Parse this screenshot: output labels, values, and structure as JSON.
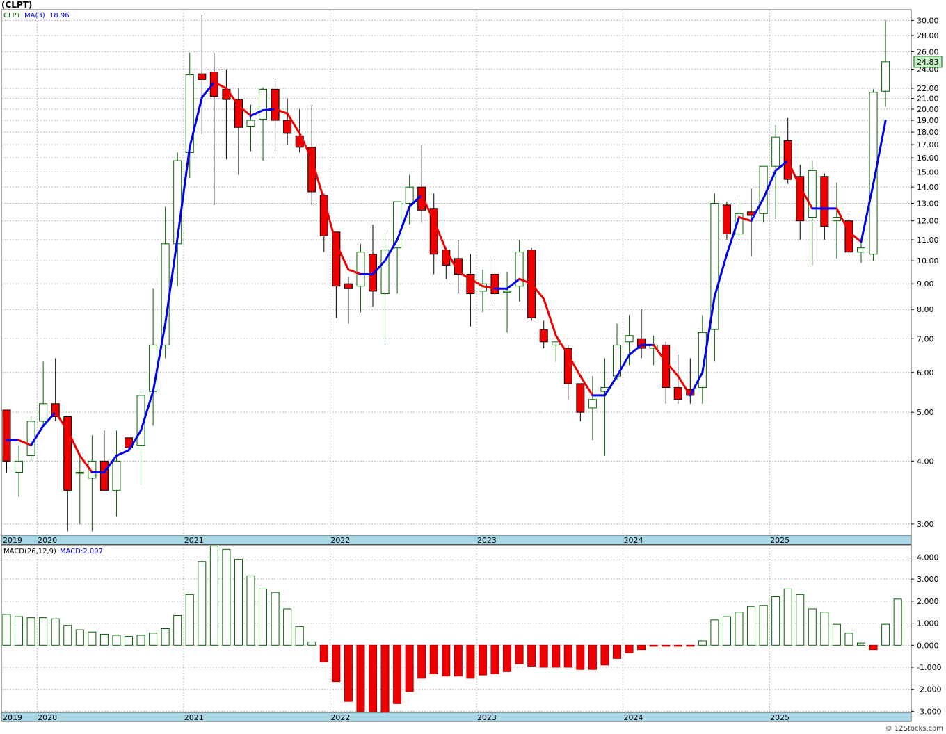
{
  "title": "(CLPT)",
  "credit": "© 12Stocks.com",
  "colors": {
    "up_outline": "#006400",
    "down_fill": "#ee0000",
    "ma_up": "#0000ee",
    "ma_down": "#ee0000",
    "grid": "#b8b8b8",
    "axis_band": "#a8d8e8",
    "price_badge": "#c8f0c8"
  },
  "price_legend": {
    "ticker": "CLPT",
    "ma_label": "MA(3)",
    "ma_value": "18.96"
  },
  "macd_legend": {
    "label": "MACD(26,12,9)",
    "value_label": "MACD:2.097"
  },
  "last_price_label": "24.83",
  "year_labels": [
    {
      "label": "2019",
      "index": -0.5
    },
    {
      "label": "2020",
      "index": 3
    },
    {
      "label": "2021",
      "index": 15
    },
    {
      "label": "2022",
      "index": 27
    },
    {
      "label": "2023",
      "index": 39
    },
    {
      "label": "2024",
      "index": 51
    },
    {
      "label": "2025",
      "index": 63
    }
  ],
  "chart_data": [
    {
      "type": "candlestick",
      "scale": "log",
      "interval": "monthly",
      "ylim": [
        2.85,
        31.5
      ],
      "y_ticks": [
        "3.00",
        "4.00",
        "5.00",
        "6.00",
        "7.00",
        "8.00",
        "9.00",
        "10.00",
        "11.00",
        "12.00",
        "13.00",
        "14.00",
        "15.00",
        "16.00",
        "17.00",
        "18.00",
        "19.00",
        "20.00",
        "21.00",
        "22.00",
        "24.00",
        "26.00",
        "28.00",
        "30.00"
      ],
      "y_tick_values": [
        3,
        4,
        5,
        6,
        7,
        8,
        9,
        10,
        11,
        12,
        13,
        14,
        15,
        16,
        17,
        18,
        19,
        20,
        21,
        22,
        24,
        26,
        28,
        30
      ],
      "grid": true,
      "ohlc": [
        [
          5.05,
          5.05,
          3.8,
          4.0
        ],
        [
          3.8,
          4.3,
          3.4,
          4.0
        ],
        [
          4.1,
          4.9,
          4.0,
          4.8
        ],
        [
          4.8,
          6.3,
          4.7,
          5.2
        ],
        [
          5.2,
          6.4,
          4.8,
          4.9
        ],
        [
          4.9,
          4.9,
          2.9,
          3.5
        ],
        [
          3.8,
          4.1,
          3.0,
          3.8
        ],
        [
          3.7,
          4.5,
          2.9,
          4.0
        ],
        [
          4.0,
          4.6,
          3.5,
          3.5
        ],
        [
          3.5,
          4.6,
          3.1,
          4.0
        ],
        [
          4.45,
          4.45,
          4.2,
          4.25
        ],
        [
          4.3,
          5.5,
          3.6,
          5.4
        ],
        [
          5.5,
          8.8,
          4.7,
          6.8
        ],
        [
          6.8,
          12.8,
          6.4,
          10.8
        ],
        [
          10.8,
          16.4,
          8.9,
          15.8
        ],
        [
          16.4,
          25.9,
          14.6,
          23.4
        ],
        [
          23.5,
          30.8,
          17.8,
          22.9
        ],
        [
          23.7,
          25.9,
          12.9,
          21.2
        ],
        [
          21.9,
          24.0,
          15.9,
          20.9
        ],
        [
          20.9,
          22.0,
          14.8,
          18.4
        ],
        [
          18.5,
          20.4,
          16.5,
          19.0
        ],
        [
          19.1,
          22.1,
          15.8,
          21.9
        ],
        [
          21.9,
          23.0,
          16.5,
          19.0
        ],
        [
          19.0,
          21.0,
          17.0,
          17.9
        ],
        [
          17.7,
          20.0,
          16.4,
          16.8
        ],
        [
          16.8,
          20.4,
          12.9,
          13.7
        ],
        [
          13.5,
          13.6,
          10.4,
          11.2
        ],
        [
          11.4,
          11.4,
          7.7,
          8.9
        ],
        [
          9.0,
          9.3,
          7.5,
          8.8
        ],
        [
          8.9,
          10.8,
          7.9,
          10.4
        ],
        [
          10.3,
          11.8,
          8.1,
          8.7
        ],
        [
          8.6,
          11.4,
          6.9,
          10.5
        ],
        [
          10.6,
          12.9,
          8.6,
          13.1
        ],
        [
          13.0,
          14.8,
          11.8,
          14.0
        ],
        [
          14.0,
          17.0,
          11.9,
          12.6
        ],
        [
          12.7,
          13.6,
          9.4,
          10.3
        ],
        [
          10.5,
          10.6,
          9.2,
          9.8
        ],
        [
          10.1,
          11.0,
          8.6,
          9.4
        ],
        [
          9.4,
          10.3,
          7.4,
          8.6
        ],
        [
          8.7,
          9.6,
          7.9,
          9.0
        ],
        [
          9.4,
          10.1,
          8.3,
          8.6
        ],
        [
          8.7,
          9.5,
          7.2,
          8.7
        ],
        [
          8.9,
          11.0,
          8.3,
          10.4
        ],
        [
          10.5,
          10.6,
          7.6,
          7.7
        ],
        [
          7.3,
          7.6,
          6.7,
          6.9
        ],
        [
          6.8,
          6.9,
          6.3,
          6.9
        ],
        [
          6.7,
          6.8,
          5.3,
          5.7
        ],
        [
          5.7,
          5.7,
          4.8,
          5.0
        ],
        [
          5.1,
          5.9,
          4.4,
          5.3
        ],
        [
          5.5,
          6.4,
          4.1,
          5.6
        ],
        [
          5.9,
          7.5,
          5.8,
          6.8
        ],
        [
          6.9,
          7.8,
          6.2,
          7.1
        ],
        [
          7.0,
          8.0,
          6.4,
          6.7
        ],
        [
          6.7,
          7.1,
          6.2,
          6.8
        ],
        [
          6.8,
          6.9,
          5.2,
          5.6
        ],
        [
          5.6,
          6.5,
          5.2,
          5.3
        ],
        [
          5.55,
          6.4,
          5.2,
          5.4
        ],
        [
          5.6,
          7.8,
          5.2,
          7.2
        ],
        [
          7.3,
          13.6,
          6.3,
          13.0
        ],
        [
          12.9,
          13.1,
          11.0,
          11.3
        ],
        [
          11.3,
          13.3,
          11.0,
          12.4
        ],
        [
          12.5,
          13.9,
          10.2,
          12.3
        ],
        [
          12.4,
          14.3,
          11.9,
          15.4
        ],
        [
          15.4,
          18.6,
          12.1,
          17.6
        ],
        [
          17.3,
          19.2,
          14.2,
          14.5
        ],
        [
          14.7,
          15.5,
          11.0,
          12.0
        ],
        [
          12.2,
          15.8,
          9.8,
          15.1
        ],
        [
          14.7,
          14.9,
          11.0,
          11.7
        ],
        [
          12.0,
          14.3,
          10.1,
          12.2
        ],
        [
          12.0,
          12.4,
          10.3,
          10.4
        ],
        [
          10.4,
          11.0,
          9.9,
          10.6
        ],
        [
          10.3,
          21.9,
          10.0,
          21.6
        ],
        [
          21.7,
          30.0,
          20.2,
          24.83
        ]
      ],
      "ma": [
        4.4,
        4.4,
        4.3,
        4.7,
        5.0,
        4.6,
        4.1,
        3.8,
        3.8,
        4.1,
        4.2,
        4.6,
        5.5,
        7.5,
        11.1,
        16.8,
        21.1,
        22.6,
        22.0,
        20.3,
        19.4,
        19.9,
        20.0,
        19.6,
        17.9,
        15.9,
        13.2,
        10.8,
        9.6,
        9.4,
        9.4,
        10.0,
        11.0,
        12.8,
        13.5,
        12.0,
        10.5,
        9.5,
        9.2,
        8.9,
        8.8,
        8.8,
        9.2,
        9.0,
        8.4,
        7.1,
        6.5,
        5.9,
        5.4,
        5.4,
        5.9,
        6.5,
        6.8,
        6.8,
        6.3,
        5.9,
        5.4,
        6.0,
        8.5,
        10.3,
        12.2,
        12.0,
        13.3,
        15.1,
        15.8,
        14.0,
        12.7,
        12.7,
        12.7,
        11.4,
        10.9,
        14.2,
        18.96
      ]
    },
    {
      "type": "bar",
      "name": "MACD(26,12,9)",
      "ylim": [
        -3.05,
        4.55
      ],
      "y_ticks": [
        "4.000",
        "3.000",
        "2.000",
        "1.000",
        "0.000",
        "-1.000",
        "-2.000",
        "-3.000"
      ],
      "y_tick_values": [
        4,
        3,
        2,
        1,
        0,
        -1,
        -2,
        -3
      ],
      "grid": true,
      "values": [
        1.4,
        1.3,
        1.25,
        1.25,
        1.2,
        0.9,
        0.7,
        0.6,
        0.5,
        0.45,
        0.4,
        0.45,
        0.55,
        0.75,
        1.35,
        2.3,
        3.8,
        4.5,
        4.35,
        3.9,
        3.15,
        2.55,
        2.4,
        1.65,
        0.85,
        0.15,
        -0.75,
        -1.65,
        -2.55,
        -3.0,
        -3.0,
        -3.05,
        -2.65,
        -2.1,
        -1.5,
        -1.3,
        -1.4,
        -1.4,
        -1.5,
        -1.35,
        -1.3,
        -1.2,
        -0.85,
        -0.95,
        -1.0,
        -1.0,
        -1.0,
        -1.1,
        -1.1,
        -0.9,
        -0.6,
        -0.35,
        -0.2,
        -0.05,
        -0.05,
        -0.05,
        -0.05,
        0.2,
        1.15,
        1.3,
        1.5,
        1.75,
        1.8,
        2.2,
        2.55,
        2.3,
        1.65,
        1.5,
        0.95,
        0.55,
        0.1,
        -0.2,
        0.95,
        2.097
      ]
    }
  ]
}
